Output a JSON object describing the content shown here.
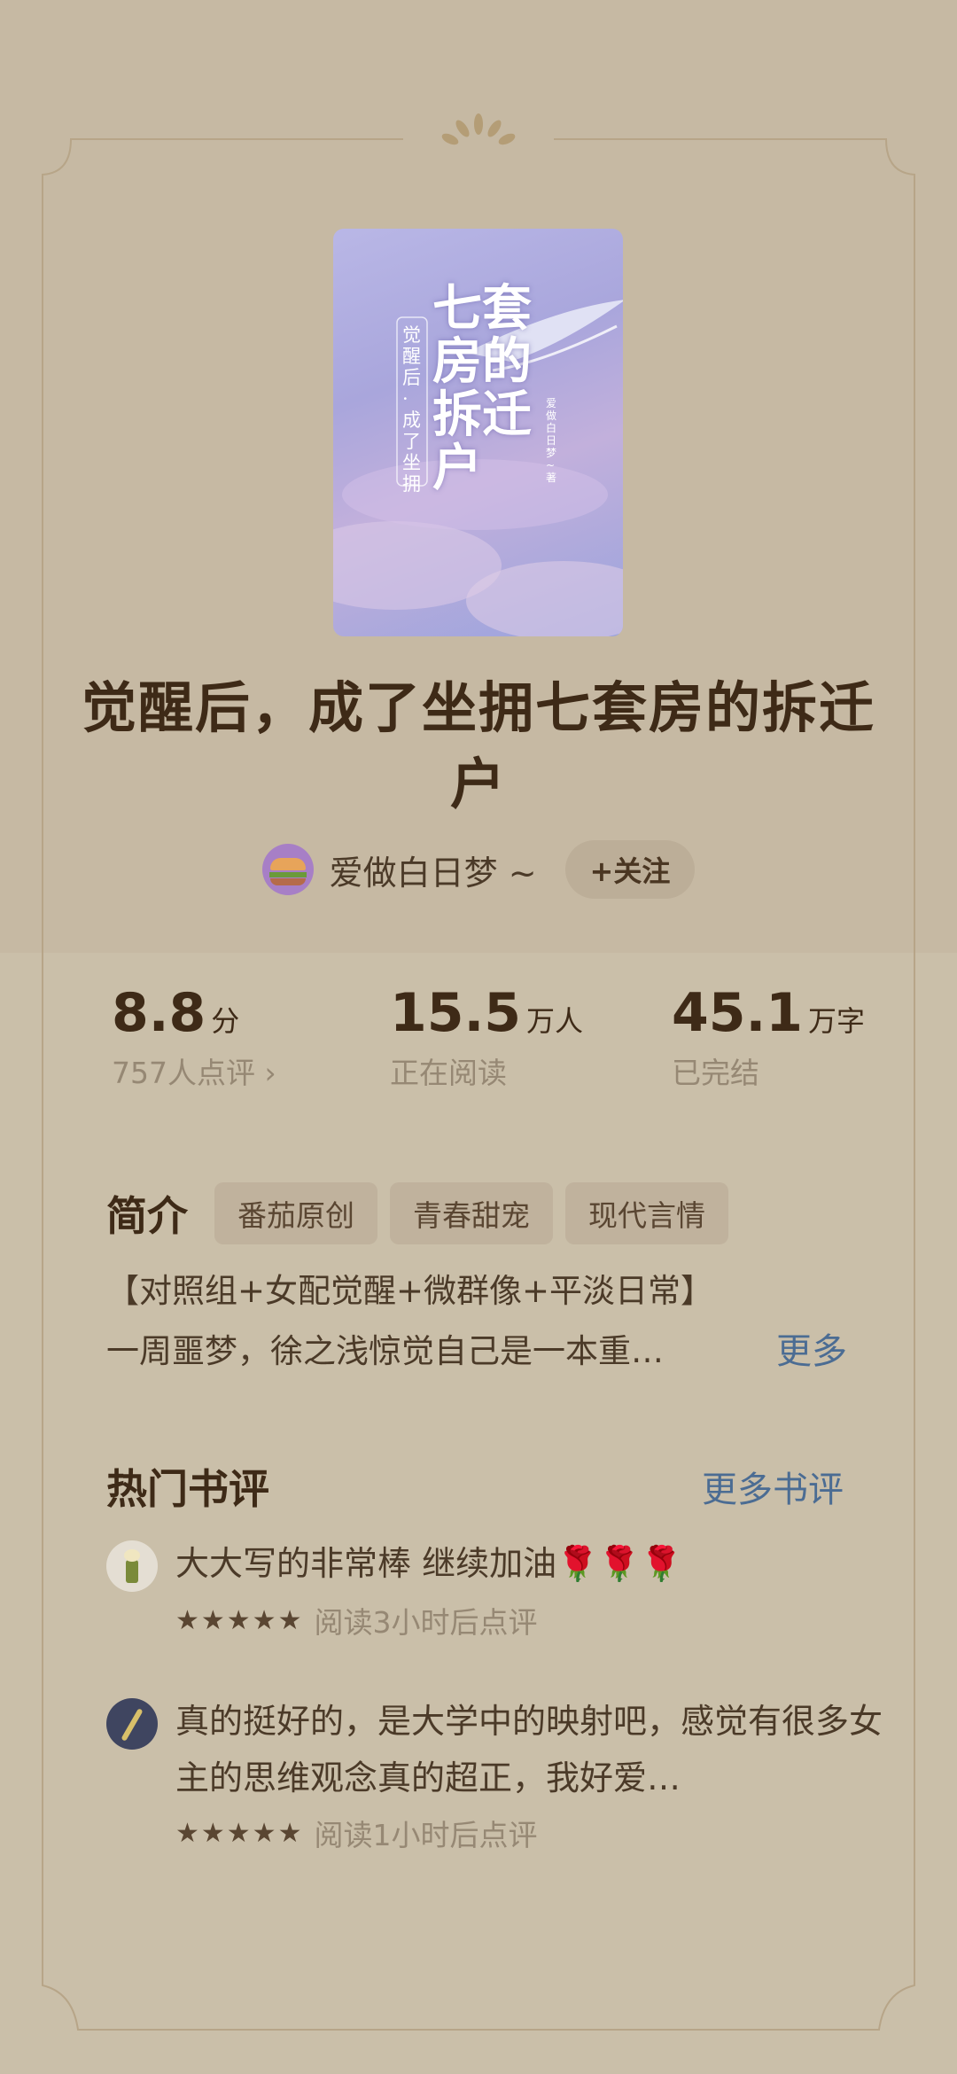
{
  "book": {
    "title": "觉醒后，成了坐拥七套房的拆迁户",
    "cover": {
      "big_title": "七套房的拆迁户",
      "vertical_subtitle": "觉醒后·成了坐拥",
      "small_author": "爱做白日梦~著"
    }
  },
  "author": {
    "name": "爱做白日梦 ~",
    "follow_label": "+关注"
  },
  "stats": [
    {
      "value": "8.8",
      "unit": "分",
      "sub": "757人点评 ›"
    },
    {
      "value": "15.5",
      "unit": "万人",
      "sub": "正在阅读"
    },
    {
      "value": "45.1",
      "unit": "万字",
      "sub": "已完结"
    }
  ],
  "intro": {
    "title": "简介",
    "tags": [
      "番茄原创",
      "青春甜宠",
      "现代言情"
    ],
    "line1": "【对照组+女配觉醒+微群像+平淡日常】",
    "line2": "一周噩梦，徐之浅惊觉自己是一本重…",
    "more": "更多"
  },
  "reviews": {
    "title": "热门书评",
    "more": "更多书评",
    "items": [
      {
        "text": "大大写的非常棒 继续加油🌹🌹🌹",
        "stars": "★★★★★",
        "time": "阅读3小时后点评"
      },
      {
        "text": "真的挺好的，是大学中的映射吧，感觉有很多女主的思维观念真的超正，我好爱…",
        "stars": "★★★★★",
        "time": "阅读1小时后点评"
      }
    ]
  },
  "colors": {
    "background": "#cabfa9",
    "title": "#3e2a17",
    "link": "#4b6c93",
    "muted": "#968874"
  }
}
